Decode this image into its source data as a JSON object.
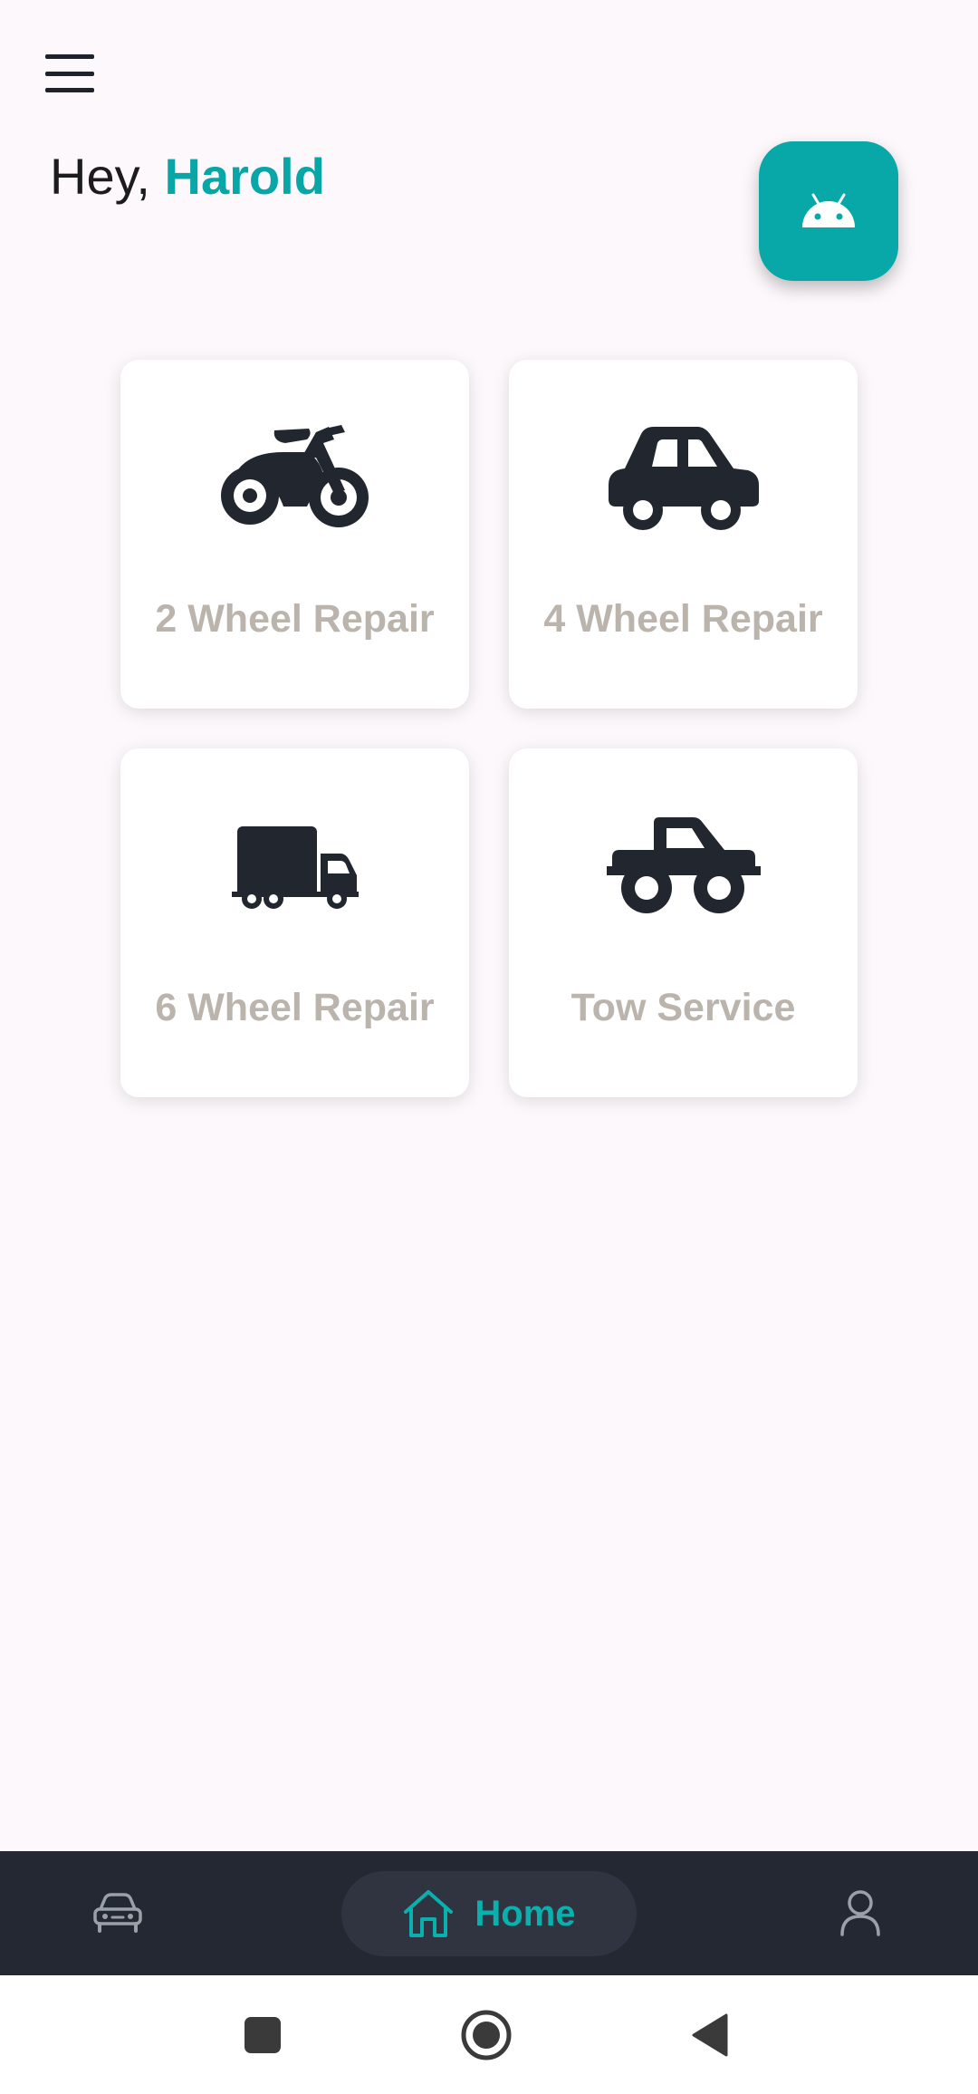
{
  "header": {
    "menu_icon": "hamburger-menu-icon",
    "greeting_prefix": "Hey, ",
    "user_name": "Harold",
    "fab_icon": "android-icon"
  },
  "services": [
    {
      "label": "2 Wheel Repair",
      "icon": "motorcycle-icon"
    },
    {
      "label": "4 Wheel Repair",
      "icon": "car-icon"
    },
    {
      "label": "6 Wheel Repair",
      "icon": "truck-icon"
    },
    {
      "label": "Tow Service",
      "icon": "pickup-truck-icon"
    }
  ],
  "bottom_nav": {
    "cars_icon": "car-outline-icon",
    "home_label": "Home",
    "home_icon": "home-icon",
    "profile_icon": "user-icon"
  },
  "system_nav": {
    "recent": "square-icon",
    "home": "circle-icon",
    "back": "triangle-back-icon"
  },
  "colors": {
    "accent": "#08a6a6",
    "background": "#fdf8fb",
    "card": "#ffffff",
    "label": "#bab4ad",
    "icon_dark": "#22262e",
    "nav_bar": "#242833"
  }
}
